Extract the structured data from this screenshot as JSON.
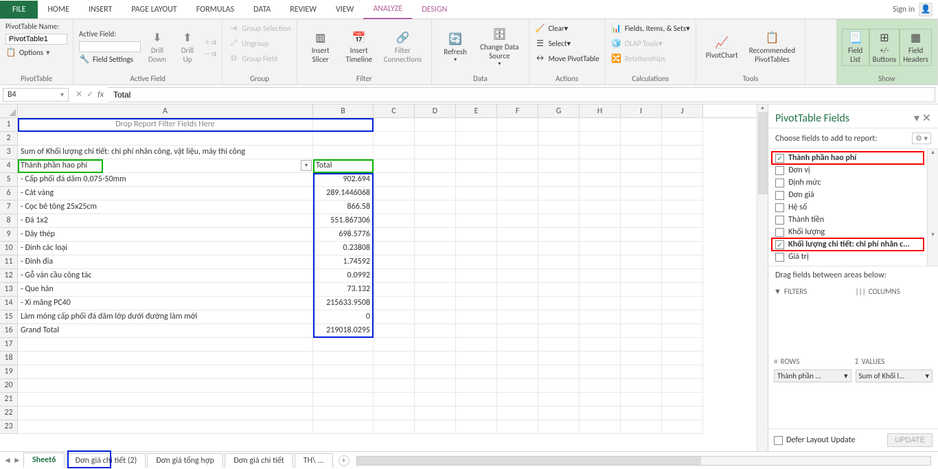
{
  "tabs": {
    "file": "FILE",
    "home": "HOME",
    "insert": "INSERT",
    "page_layout": "PAGE LAYOUT",
    "formulas": "FORMULAS",
    "data": "DATA",
    "review": "REVIEW",
    "view": "VIEW",
    "analyze": "ANALYZE",
    "design": "DESIGN"
  },
  "signin": "Sign in",
  "ribbon": {
    "pt_name_label": "PivotTable Name:",
    "pt_name": "PivotTable1",
    "options": "Options",
    "group_pt": "PivotTable",
    "active_field_label": "Active Field:",
    "field_settings": "Field Settings",
    "drill_down": "Drill\nDown",
    "drill_up": "Drill\nUp",
    "group_active": "Active Field",
    "grp_selection": "Group Selection",
    "ungroup": "Ungroup",
    "group_field": "Group Field",
    "group_group": "Group",
    "insert_slicer": "Insert\nSlicer",
    "insert_timeline": "Insert\nTimeline",
    "filter_conn": "Filter\nConnections",
    "group_filter": "Filter",
    "refresh": "Refresh",
    "change_ds": "Change Data\nSource",
    "group_data": "Data",
    "clear": "Clear",
    "select": "Select",
    "move_pt": "Move PivotTable",
    "group_actions": "Actions",
    "fields_items": "Fields, Items, & Sets",
    "olap": "OLAP Tools",
    "relationships": "Relationships",
    "group_calc": "Calculations",
    "pivotchart": "PivotChart",
    "rec_pt": "Recommended\nPivotTables",
    "group_tools": "Tools",
    "field_list": "Field\nList",
    "buttons": "+/-\nButtons",
    "field_headers": "Field\nHeaders",
    "group_show": "Show"
  },
  "namebox": "B4",
  "formula": "Total",
  "columns": [
    "A",
    "B",
    "C",
    "D",
    "E",
    "F",
    "G",
    "H",
    "I",
    "J"
  ],
  "rows": {
    "r1": {
      "A": "Drop Report Filter Fields Here"
    },
    "r3": {
      "A": "Sum of Khối lượng chi tiết: chi phí nhân công, vật liệu, máy thi công"
    },
    "r4": {
      "A": "Thành phần hao phí",
      "B": "Total"
    },
    "r5": {
      "A": " - Cấp phối đá dăm 0,075-50mm",
      "B": "902.694"
    },
    "r6": {
      "A": " - Cát vàng",
      "B": "289.1446068"
    },
    "r7": {
      "A": " - Cọc bê tông 25x25cm",
      "B": "866.58"
    },
    "r8": {
      "A": " - Đá 1x2",
      "B": "551.867306"
    },
    "r9": {
      "A": " - Dây thép",
      "B": "698.5776"
    },
    "r10": {
      "A": " - Đinh các loại",
      "B": "0.23808"
    },
    "r11": {
      "A": " - Đinh đỉa",
      "B": "1.74592"
    },
    "r12": {
      "A": " - Gỗ ván cầu công tác",
      "B": "0.0992"
    },
    "r13": {
      "A": " - Que hàn",
      "B": "73.132"
    },
    "r14": {
      "A": " - Xi măng PC40",
      "B": "215633.9508"
    },
    "r15": {
      "A": "Làm móng cấp phối đá dăm lớp dưới đường làm mới",
      "B": "0"
    },
    "r16": {
      "A": "Grand Total",
      "B": "219018.0295"
    }
  },
  "pane": {
    "title": "PivotTable Fields",
    "subtitle": "Choose fields to add to report:",
    "fields": [
      {
        "label": "Thành phần hao phí",
        "checked": true,
        "hl": true
      },
      {
        "label": "Đơn vị",
        "checked": false
      },
      {
        "label": "Định mức",
        "checked": false
      },
      {
        "label": "Đơn giá",
        "checked": false
      },
      {
        "label": "Hệ số",
        "checked": false
      },
      {
        "label": "Thành tiền",
        "checked": false
      },
      {
        "label": "Khối lượng",
        "checked": false
      },
      {
        "label": "Khối lượng chi tiết: chi phí nhân c...",
        "checked": true,
        "hl": true
      },
      {
        "label": "Giá trị",
        "checked": false
      }
    ],
    "drag_label": "Drag fields between areas below:",
    "filters": "FILTERS",
    "columns": "COLUMNS",
    "rows_area": "ROWS",
    "values": "VALUES",
    "row_tag": "Thành phần ...",
    "val_tag": "Sum of Khối l...",
    "defer": "Defer Layout Update",
    "update": "UPDATE"
  },
  "sheets": {
    "s1": "Sheet6",
    "s2": "Đơn giá chi tiết (2)",
    "s3": "Đơn giá tổng hợp",
    "s4": "Đơn giá chi tiết",
    "s5": "TH\\"
  }
}
